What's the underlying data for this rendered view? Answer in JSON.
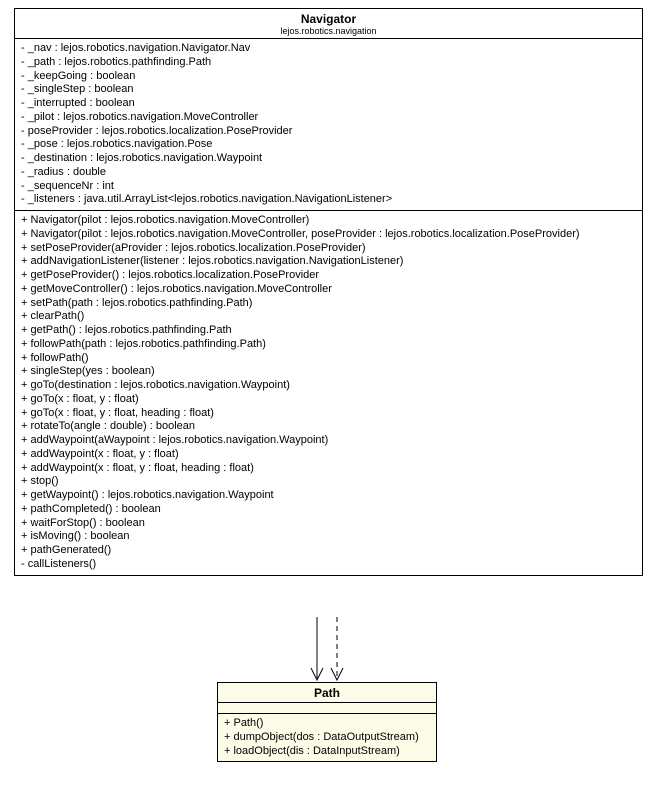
{
  "navigator": {
    "classname": "Navigator",
    "package": "lejos.robotics.navigation",
    "fields": [
      "- _nav : lejos.robotics.navigation.Navigator.Nav",
      "- _path : lejos.robotics.pathfinding.Path",
      "- _keepGoing : boolean",
      "- _singleStep : boolean",
      "- _interrupted : boolean",
      "- _pilot : lejos.robotics.navigation.MoveController",
      "- poseProvider : lejos.robotics.localization.PoseProvider",
      "- _pose : lejos.robotics.navigation.Pose",
      "- _destination : lejos.robotics.navigation.Waypoint",
      "- _radius : double",
      "- _sequenceNr : int",
      "- _listeners : java.util.ArrayList<lejos.robotics.navigation.NavigationListener>"
    ],
    "methods": [
      "+ Navigator(pilot : lejos.robotics.navigation.MoveController)",
      "+ Navigator(pilot : lejos.robotics.navigation.MoveController, poseProvider : lejos.robotics.localization.PoseProvider)",
      "+ setPoseProvider(aProvider : lejos.robotics.localization.PoseProvider)",
      "+ addNavigationListener(listener : lejos.robotics.navigation.NavigationListener)",
      "+ getPoseProvider() : lejos.robotics.localization.PoseProvider",
      "+ getMoveController() : lejos.robotics.navigation.MoveController",
      "+ setPath(path : lejos.robotics.pathfinding.Path)",
      "+ clearPath()",
      "+ getPath() : lejos.robotics.pathfinding.Path",
      "+ followPath(path : lejos.robotics.pathfinding.Path)",
      "+ followPath()",
      "+ singleStep(yes : boolean)",
      "+ goTo(destination : lejos.robotics.navigation.Waypoint)",
      "+ goTo(x : float, y : float)",
      "+ goTo(x : float, y : float, heading : float)",
      "+ rotateTo(angle : double) : boolean",
      "+ addWaypoint(aWaypoint : lejos.robotics.navigation.Waypoint)",
      "+ addWaypoint(x : float, y : float)",
      "+ addWaypoint(x : float, y : float, heading : float)",
      "+ stop()",
      "+ getWaypoint() : lejos.robotics.navigation.Waypoint",
      "+ pathCompleted() : boolean",
      "+ waitForStop() : boolean",
      "+ isMoving() : boolean",
      "+ pathGenerated()",
      "- callListeners()"
    ]
  },
  "path": {
    "classname": "Path",
    "methods": [
      "+ Path()",
      "+ dumpObject(dos : DataOutputStream)",
      "+ loadObject(dis : DataInputStream)"
    ]
  }
}
